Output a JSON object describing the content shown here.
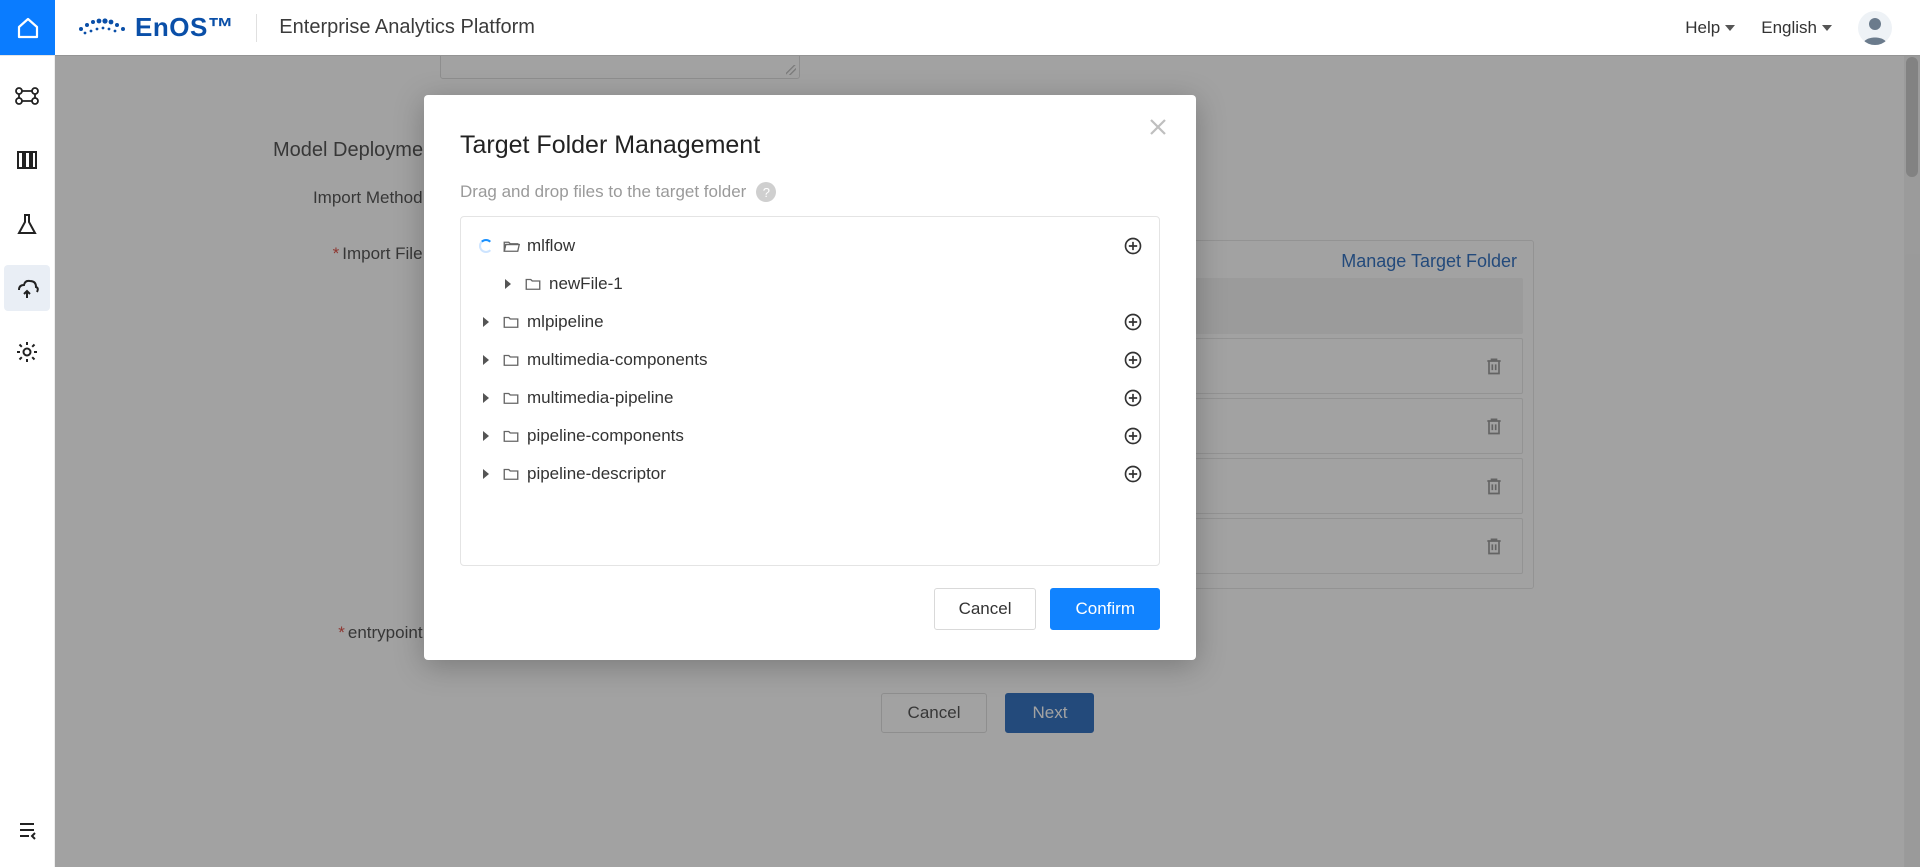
{
  "header": {
    "brand": "EnOS™",
    "app_title": "Enterprise Analytics Platform",
    "help": "Help",
    "language": "English"
  },
  "page": {
    "section_title": "Model Deployment",
    "import_method_label": "Import Method :",
    "import_file_label": "Import File :",
    "entrypoint_label": "entrypoint :",
    "manage_target_link": "Manage Target Folder",
    "cancel": "Cancel",
    "next": "Next"
  },
  "modal": {
    "title": "Target Folder Management",
    "subtitle": "Drag and drop files to the target folder",
    "cancel": "Cancel",
    "confirm": "Confirm",
    "tree": [
      {
        "label": "mlflow",
        "open": true,
        "level": 1,
        "loading": true,
        "plus": true
      },
      {
        "label": "newFile-1",
        "open": false,
        "level": 2,
        "caret": true,
        "plus": false
      },
      {
        "label": "mlpipeline",
        "open": false,
        "level": 1,
        "caret": true,
        "plus": true
      },
      {
        "label": "multimedia-components",
        "open": false,
        "level": 1,
        "caret": true,
        "plus": true
      },
      {
        "label": "multimedia-pipeline",
        "open": false,
        "level": 1,
        "caret": true,
        "plus": true
      },
      {
        "label": "pipeline-components",
        "open": false,
        "level": 1,
        "caret": true,
        "plus": true
      },
      {
        "label": "pipeline-descriptor",
        "open": false,
        "level": 1,
        "caret": true,
        "plus": true
      }
    ]
  }
}
